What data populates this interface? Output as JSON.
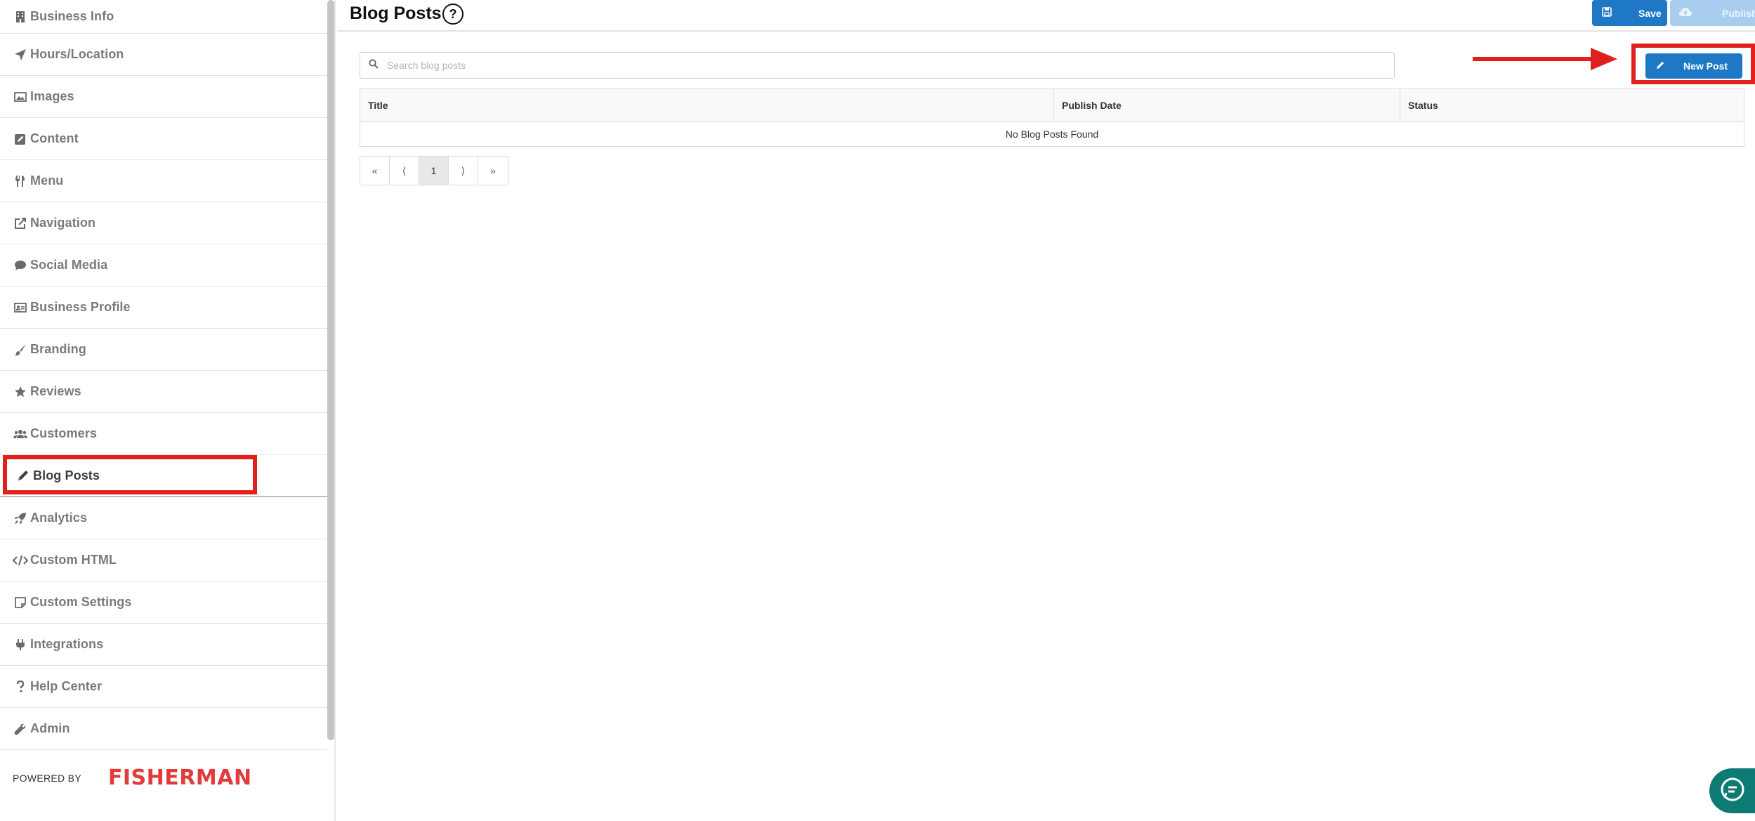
{
  "sidebar": {
    "items": [
      {
        "label": "Business Info",
        "icon": "building-icon"
      },
      {
        "label": "Hours/Location",
        "icon": "location-arrow-icon"
      },
      {
        "label": "Images",
        "icon": "image-icon"
      },
      {
        "label": "Content",
        "icon": "edit-icon"
      },
      {
        "label": "Menu",
        "icon": "utensils-icon"
      },
      {
        "label": "Navigation",
        "icon": "external-link-icon"
      },
      {
        "label": "Social Media",
        "icon": "comment-icon"
      },
      {
        "label": "Business Profile",
        "icon": "id-card-icon"
      },
      {
        "label": "Branding",
        "icon": "paint-brush-icon"
      },
      {
        "label": "Reviews",
        "icon": "star-icon"
      },
      {
        "label": "Customers",
        "icon": "users-icon"
      },
      {
        "label": "Blog Posts",
        "icon": "pencil-icon",
        "active": true
      },
      {
        "label": "Analytics",
        "icon": "rocket-icon"
      },
      {
        "label": "Custom HTML",
        "icon": "code-icon"
      },
      {
        "label": "Custom Settings",
        "icon": "sticky-note-icon"
      },
      {
        "label": "Integrations",
        "icon": "plug-icon"
      },
      {
        "label": "Help Center",
        "icon": "question-icon"
      },
      {
        "label": "Admin",
        "icon": "wrench-icon"
      }
    ],
    "powered_by": "POWERED BY",
    "brand": "FISHERMAN"
  },
  "header": {
    "title": "Blog Posts",
    "help": "?",
    "save_label": "Save",
    "publish_label": "Publish"
  },
  "main": {
    "search_placeholder": "Search blog posts",
    "search_value": "",
    "new_post_label": "New Post",
    "table": {
      "columns": [
        "Title",
        "Publish Date",
        "Status"
      ],
      "empty_message": "No Blog Posts Found"
    },
    "pager": [
      "«",
      "⟨",
      "1",
      "⟩",
      "»"
    ],
    "current_page": "1"
  },
  "colors": {
    "primary": "#1f78c5",
    "primary_disabled": "#a8cdee",
    "highlight": "#e0201d",
    "brand": "#e23b3b",
    "chat": "#0d7a74"
  }
}
